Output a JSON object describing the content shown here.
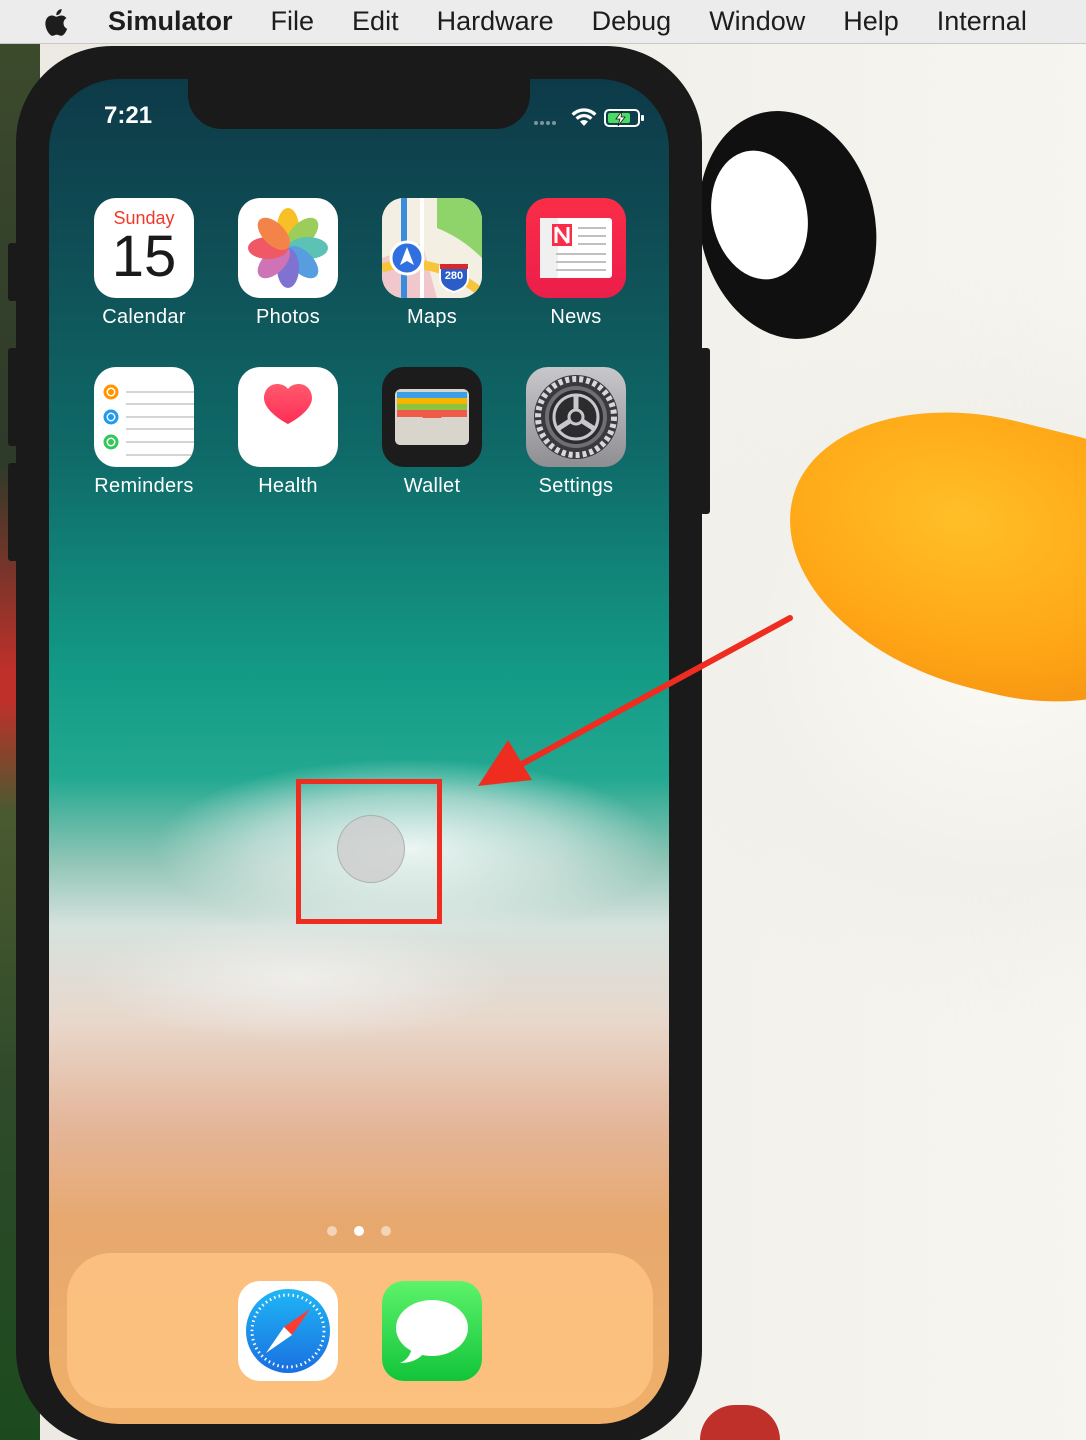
{
  "menubar": {
    "apple_icon": "apple-logo-icon",
    "items": [
      "Simulator",
      "File",
      "Edit",
      "Hardware",
      "Debug",
      "Window",
      "Help",
      "Internal"
    ]
  },
  "status_bar": {
    "time": "7:21",
    "icons": [
      "cellular-dots-icon",
      "wifi-icon",
      "battery-charging-icon"
    ]
  },
  "calendar_icon": {
    "weekday": "Sunday",
    "day": "15"
  },
  "maps_icon": {
    "shield": "280"
  },
  "apps": [
    {
      "label": "Calendar",
      "icon": "calendar-icon"
    },
    {
      "label": "Photos",
      "icon": "photos-icon"
    },
    {
      "label": "Maps",
      "icon": "maps-icon"
    },
    {
      "label": "News",
      "icon": "news-icon"
    },
    {
      "label": "Reminders",
      "icon": "reminders-icon"
    },
    {
      "label": "Health",
      "icon": "health-icon"
    },
    {
      "label": "Wallet",
      "icon": "wallet-icon"
    },
    {
      "label": "Settings",
      "icon": "settings-icon"
    }
  ],
  "page_indicator": {
    "count": 3,
    "current": 2
  },
  "dock": [
    {
      "icon": "safari-icon"
    },
    {
      "icon": "messages-icon"
    }
  ],
  "annotation": {
    "color": "#ee2d20"
  }
}
